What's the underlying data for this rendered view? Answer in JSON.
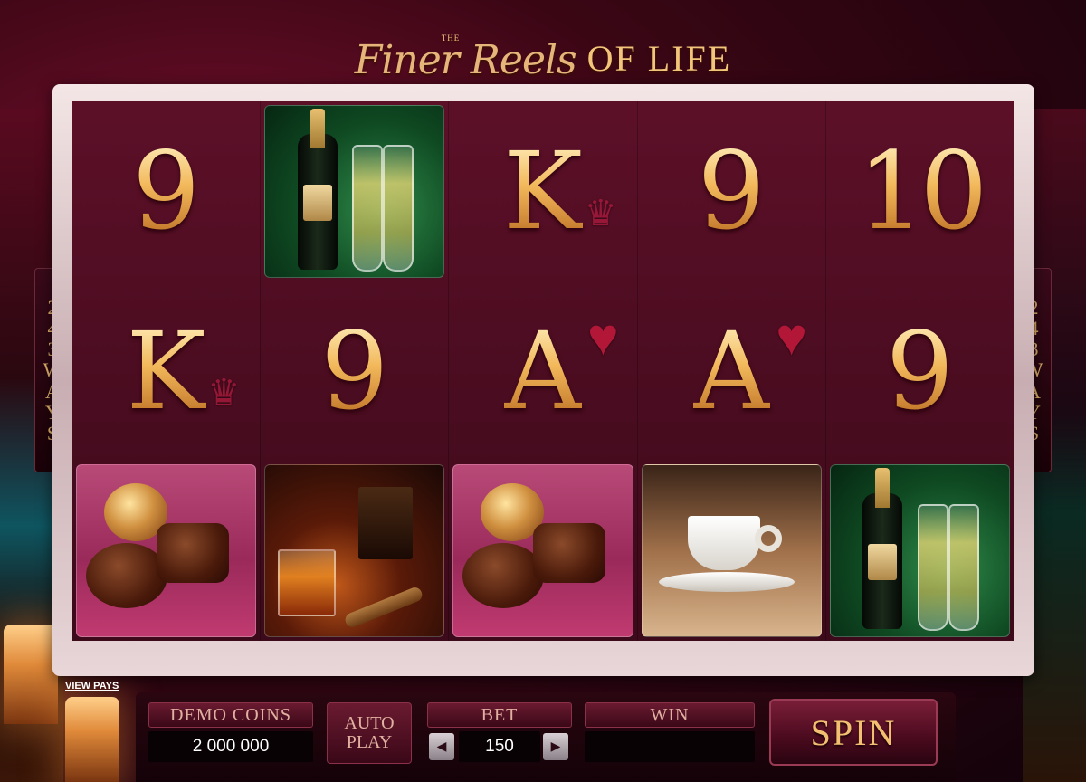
{
  "title": {
    "the": "THE",
    "script": "Finer Reels",
    "main": "OF LIFE"
  },
  "ways": {
    "digits": [
      "2",
      "4",
      "3"
    ],
    "letters": [
      "W",
      "A",
      "Y",
      "S"
    ]
  },
  "reels": [
    [
      {
        "symbol": "9",
        "kind": "number"
      },
      {
        "symbol": "K",
        "kind": "king",
        "suit": "♛"
      },
      {
        "symbol": "chocolates",
        "kind": "image"
      }
    ],
    [
      {
        "symbol": "champagne",
        "kind": "image"
      },
      {
        "symbol": "9",
        "kind": "number"
      },
      {
        "symbol": "whisky-cigar",
        "kind": "image"
      }
    ],
    [
      {
        "symbol": "K",
        "kind": "king",
        "suit": "♛"
      },
      {
        "symbol": "A",
        "kind": "ace",
        "suit": "♥"
      },
      {
        "symbol": "chocolates",
        "kind": "image"
      }
    ],
    [
      {
        "symbol": "9",
        "kind": "number"
      },
      {
        "symbol": "A",
        "kind": "ace",
        "suit": "♥"
      },
      {
        "symbol": "coffee",
        "kind": "image"
      }
    ],
    [
      {
        "symbol": "10",
        "kind": "number"
      },
      {
        "symbol": "9",
        "kind": "number"
      },
      {
        "symbol": "champagne",
        "kind": "image"
      }
    ]
  ],
  "controls": {
    "view_pays": "VIEW PAYS",
    "coins_label": "DEMO COINS",
    "coins_value": "2 000 000",
    "autoplay_line1": "AUTO",
    "autoplay_line2": "PLAY",
    "bet_label": "BET",
    "bet_value": "150",
    "bet_decrease": "◀",
    "bet_increase": "▶",
    "win_label": "WIN",
    "win_value": "",
    "spin": "SPIN"
  },
  "colors": {
    "gold": "#f2c070",
    "reel_bg": "#4a0c20",
    "suit_red": "#b8183a"
  }
}
